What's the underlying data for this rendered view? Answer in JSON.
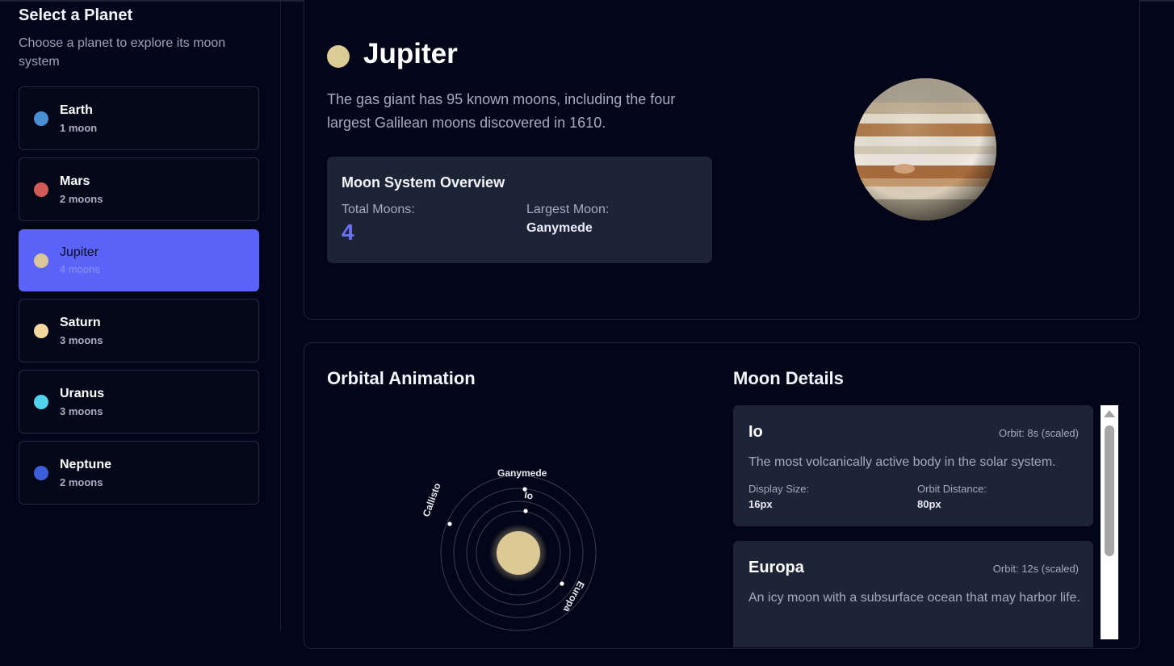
{
  "sidebar": {
    "title": "Select a Planet",
    "subtitle": "Choose a planet to explore its moon system",
    "planets": [
      {
        "name": "Earth",
        "count": "1 moon",
        "color": "#4a8fd4"
      },
      {
        "name": "Mars",
        "count": "2 moons",
        "color": "#d25a58"
      },
      {
        "name": "Jupiter",
        "count": "4 moons",
        "color": "#d9c79a"
      },
      {
        "name": "Saturn",
        "count": "3 moons",
        "color": "#f5d8a0"
      },
      {
        "name": "Uranus",
        "count": "3 moons",
        "color": "#4fd4ec"
      },
      {
        "name": "Neptune",
        "count": "2 moons",
        "color": "#3b5fdc"
      }
    ],
    "active_planet": "Jupiter"
  },
  "planet": {
    "name": "Jupiter",
    "color": "#dccb96",
    "description": "The gas giant has 95 known moons, including the four largest Galilean moons discovered in 1610.",
    "overview": {
      "title": "Moon System Overview",
      "total_label": "Total Moons:",
      "total_value": "4",
      "largest_label": "Largest Moon:",
      "largest_value": "Ganymede"
    }
  },
  "orbital": {
    "title": "Orbital Animation",
    "moons": [
      "Ganymede",
      "Io",
      "Callisto",
      "Europa"
    ]
  },
  "details": {
    "title": "Moon Details",
    "moons": [
      {
        "name": "Io",
        "orbit": "Orbit: 8s (scaled)",
        "description": "The most volcanically active body in the solar system.",
        "size_label": "Display Size:",
        "size_value": "16px",
        "distance_label": "Orbit Distance:",
        "distance_value": "80px"
      },
      {
        "name": "Europa",
        "orbit": "Orbit: 12s (scaled)",
        "description": "An icy moon with a subsurface ocean that may harbor life."
      }
    ]
  },
  "colors": {
    "accent": "#5b63f8",
    "background": "#03061a",
    "card": "#1c2436"
  }
}
